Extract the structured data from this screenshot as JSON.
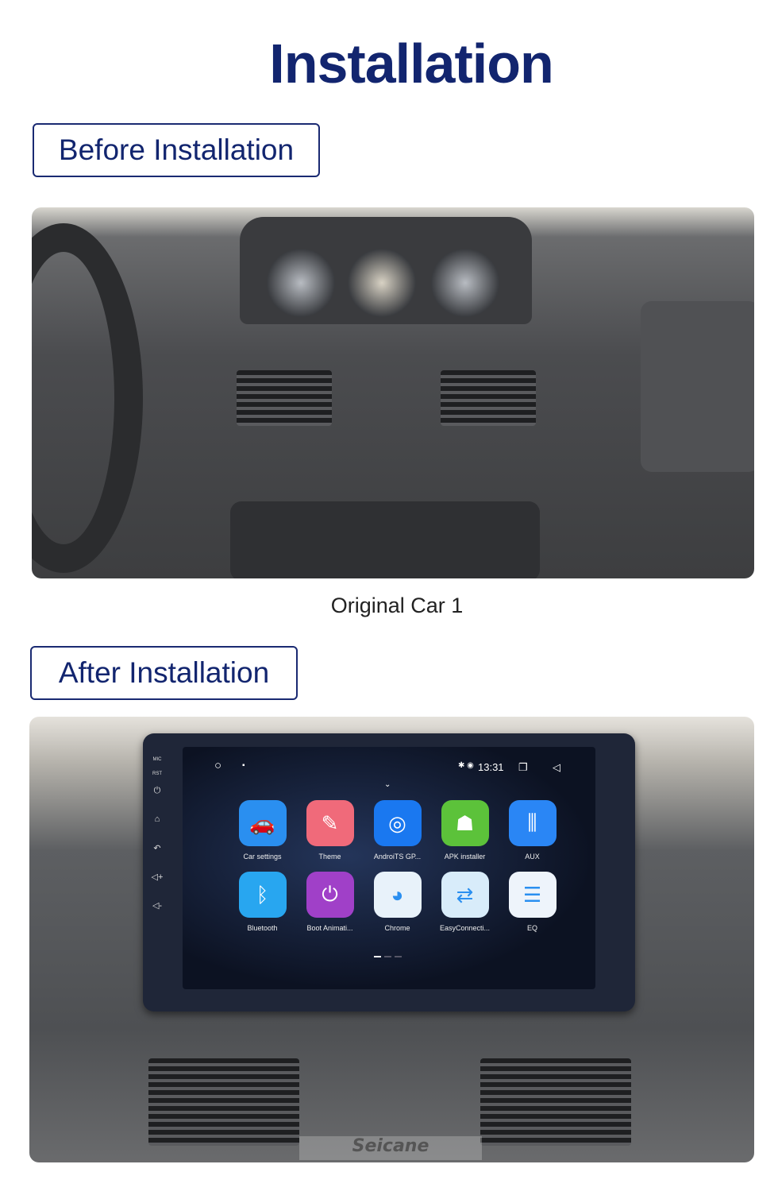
{
  "title": "Installation",
  "before": {
    "label": "Before Installation",
    "caption": "Original Car  1"
  },
  "after": {
    "label": "After Installation"
  },
  "screen": {
    "side_labels": [
      "MIC",
      "RST"
    ],
    "time": "13:31",
    "apps": [
      {
        "label": "Car settings",
        "icon": "car-settings-icon",
        "color": "#2a8ff0"
      },
      {
        "label": "Theme",
        "icon": "theme-brush-icon",
        "color": "#f06a7a"
      },
      {
        "label": "AndroiTS GP...",
        "icon": "gps-radar-icon",
        "color": "#1a78f0"
      },
      {
        "label": "APK installer",
        "icon": "android-icon",
        "color": "#5cc23a"
      },
      {
        "label": "AUX",
        "icon": "aux-icon",
        "color": "#2a86f5"
      },
      {
        "label": "Bluetooth",
        "icon": "bluetooth-icon",
        "color": "#28a6f0"
      },
      {
        "label": "Boot Animati...",
        "icon": "power-icon",
        "color": "#a040c8"
      },
      {
        "label": "Chrome",
        "icon": "chrome-icon",
        "color": "#e8f2fa"
      },
      {
        "label": "EasyConnecti...",
        "icon": "easyconnect-icon",
        "color": "#d8ecfa"
      },
      {
        "label": "EQ",
        "icon": "eq-icon",
        "color": "#eef4fb"
      }
    ]
  },
  "watermark": "Seicane"
}
